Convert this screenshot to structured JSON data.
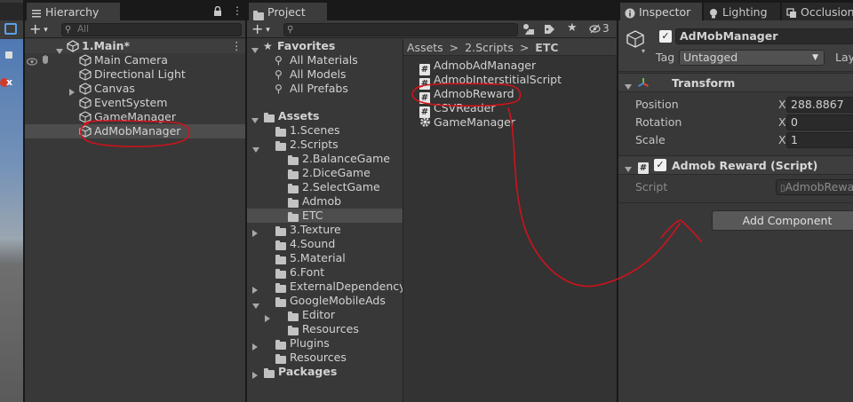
{
  "colors": {
    "annotation": "#d0121b",
    "panel_bg": "#383838",
    "selected_row": "#4d4d4d",
    "scene_sky": "#5d7fb1"
  },
  "hierarchy": {
    "tab_label": "Hierarchy",
    "search_placeholder": "All",
    "scene_name": "1.Main*",
    "items": [
      {
        "label": "Main Camera"
      },
      {
        "label": "Directional Light"
      },
      {
        "label": "Canvas"
      },
      {
        "label": "EventSystem"
      },
      {
        "label": "GameManager"
      },
      {
        "label": "AdMobManager"
      }
    ]
  },
  "project": {
    "tab_label": "Project",
    "hidden_count": "3",
    "favorites": {
      "label": "Favorites",
      "items": [
        "All Materials",
        "All Models",
        "All Prefabs"
      ]
    },
    "assets_label": "Assets",
    "tree": [
      "1.Scenes",
      "2.Scripts",
      "2.BalanceGame",
      "2.DiceGame",
      "2.SelectGame",
      "Admob",
      "ETC",
      "3.Texture",
      "4.Sound",
      "5.Material",
      "6.Font",
      "ExternalDependencyM",
      "GoogleMobileAds",
      "Editor",
      "Resources",
      "Plugins",
      "Resources"
    ],
    "packages_label": "Packages",
    "breadcrumb": [
      "Assets",
      "2.Scripts",
      "ETC"
    ],
    "files": [
      {
        "label": "AdmobAdManager",
        "icon": "csharp-script-icon"
      },
      {
        "label": "AdmobInterstitialScript",
        "icon": "csharp-script-icon"
      },
      {
        "label": "AdmobReward",
        "icon": "csharp-script-icon"
      },
      {
        "label": "CSVReader",
        "icon": "csharp-script-icon"
      },
      {
        "label": "GameManager",
        "icon": "gear-icon"
      }
    ]
  },
  "inspector": {
    "tabs": [
      "Inspector",
      "Lighting",
      "Occlusion"
    ],
    "object_name": "AdMobManager",
    "active": true,
    "tag_label": "Tag",
    "tag_value": "Untagged",
    "layer_label": "Lay",
    "transform": {
      "title": "Transform",
      "position_label": "Position",
      "position_x": "288.8867",
      "rotation_label": "Rotation",
      "rotation_x": "0",
      "scale_label": "Scale",
      "scale_x": "1",
      "axis_x": "X"
    },
    "component": {
      "title": "Admob Reward (Script)",
      "enabled": true,
      "script_label": "Script",
      "script_value": "AdmobRewa"
    },
    "add_component_label": "Add Component"
  }
}
